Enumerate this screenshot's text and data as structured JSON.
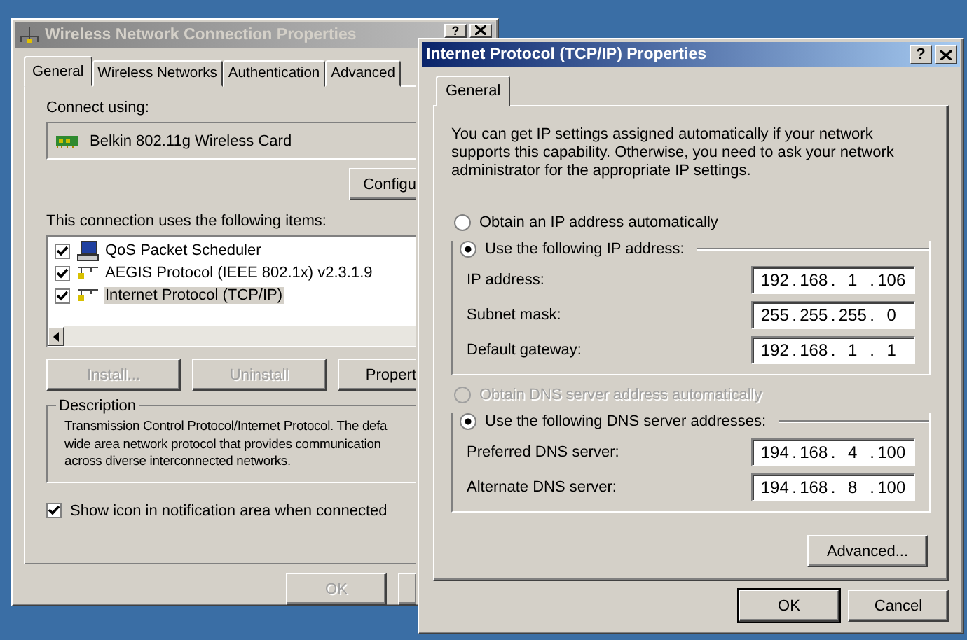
{
  "back_window": {
    "title": "Wireless Network Connection Properties",
    "help_button": "?",
    "tabs": [
      {
        "label": "General",
        "selected": true
      },
      {
        "label": "Wireless Networks",
        "selected": false
      },
      {
        "label": "Authentication",
        "selected": false
      },
      {
        "label": "Advanced",
        "selected": false
      }
    ],
    "connect_using_label": "Connect using:",
    "adapter": "Belkin 802.11g Wireless Card",
    "configure_button": "Configu",
    "items_label": "This connection uses the following items:",
    "items": [
      {
        "kind": "scheduler",
        "label": "QoS Packet Scheduler",
        "checked": true,
        "selected": false
      },
      {
        "kind": "protocol",
        "label": "AEGIS Protocol (IEEE 802.1x) v2.3.1.9",
        "checked": true,
        "selected": false
      },
      {
        "kind": "protocol",
        "label": "Internet Protocol (TCP/IP)",
        "checked": true,
        "selected": true
      }
    ],
    "item_buttons": [
      {
        "label": "Install...",
        "disabled": true
      },
      {
        "label": "Uninstall",
        "disabled": true
      },
      {
        "label": "Propert",
        "disabled": false
      }
    ],
    "description": {
      "title": "Description",
      "lines": [
        "Transmission Control Protocol/Internet Protocol. The defa",
        "wide area network protocol that provides communication",
        "across diverse interconnected networks."
      ]
    },
    "show_icon": {
      "label": "Show icon in notification area when connected",
      "checked": true
    },
    "ok_button": {
      "label": "OK",
      "disabled": true
    }
  },
  "front_window": {
    "title": "Internet Protocol (TCP/IP) Properties",
    "help_button": "?",
    "tabs": [
      {
        "label": "General",
        "selected": true
      }
    ],
    "intro": "You can get IP settings assigned automatically if your network supports this capability. Otherwise, you need to ask your network administrator for the appropriate IP settings.",
    "separator": ".",
    "ip_options": [
      {
        "label": "Obtain an IP address automatically",
        "selected": false,
        "disabled": false
      },
      {
        "label": "Use the following IP address:",
        "selected": true,
        "disabled": false
      }
    ],
    "ip_fields": [
      {
        "label": "IP address:",
        "octets": [
          "192",
          "168",
          "1",
          "106"
        ]
      },
      {
        "label": "Subnet mask:",
        "octets": [
          "255",
          "255",
          "255",
          "0"
        ]
      },
      {
        "label": "Default gateway:",
        "octets": [
          "192",
          "168",
          "1",
          "1"
        ]
      }
    ],
    "dns_options": [
      {
        "label": "Obtain DNS server address automatically",
        "selected": false,
        "disabled": true
      },
      {
        "label": "Use the following DNS server addresses:",
        "selected": true,
        "disabled": false
      }
    ],
    "dns_fields": [
      {
        "label": "Preferred DNS server:",
        "octets": [
          "194",
          "168",
          "4",
          "100"
        ]
      },
      {
        "label": "Alternate DNS server:",
        "octets": [
          "194",
          "168",
          "8",
          "100"
        ]
      }
    ],
    "advanced_button": "Advanced...",
    "ok_button": "OK",
    "cancel_button": "Cancel"
  }
}
